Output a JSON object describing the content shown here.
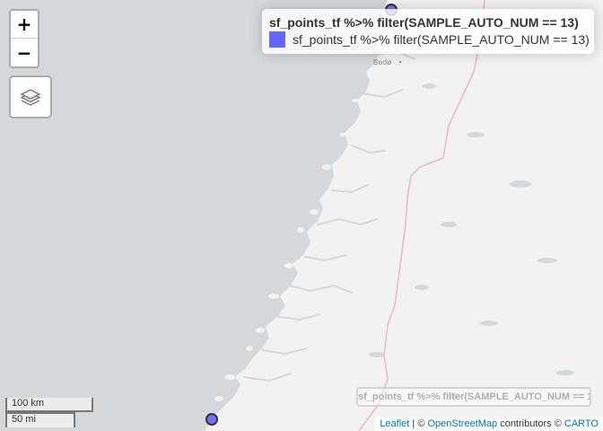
{
  "zoom": {
    "plus_label": "+",
    "minus_label": "−"
  },
  "layers": {
    "icon": "layers-icon"
  },
  "legend": {
    "title": "sf_points_tf %>% filter(SAMPLE_AUTO_NUM == 13)",
    "items": [
      {
        "label": "sf_points_tf %>% filter(SAMPLE_AUTO_NUM == 13)",
        "color": "#6666ff"
      }
    ]
  },
  "overlay_label": "sf_points_tf %>% filter(SAMPLE_AUTO_NUM == 13)",
  "place_labels": {
    "bodo": "Bodø"
  },
  "scale": {
    "km": "100 km",
    "mi": "50 mi"
  },
  "attribution": {
    "leaflet": "Leaflet",
    "sep": " | © ",
    "osm": "OpenStreetMap",
    "contrib": " contributors © ",
    "carto": "CARTO"
  },
  "colors": {
    "water": "#d4d8da",
    "land": "#f2f2f2",
    "border": "#e8b8c0",
    "marker_fill": "#6666ff",
    "marker_stroke": "#333333"
  }
}
